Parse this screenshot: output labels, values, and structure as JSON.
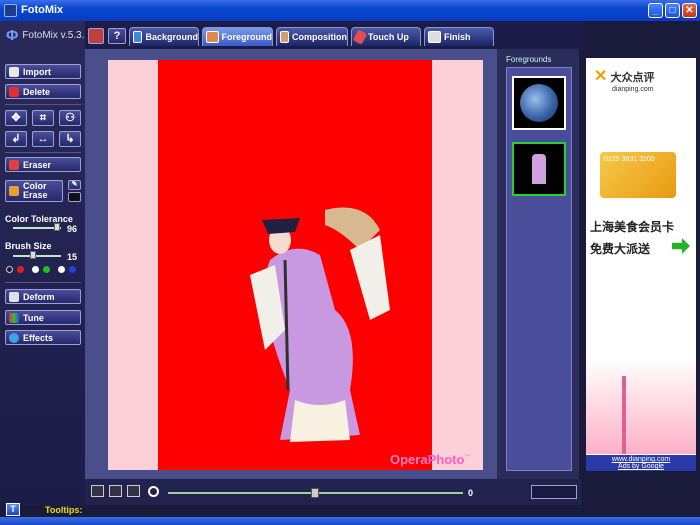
{
  "window": {
    "title": "FotoMix",
    "min": "_",
    "max": "□",
    "close": "✕"
  },
  "app": {
    "name": "FotoMix v.5.3."
  },
  "tabs": [
    {
      "label": "Background"
    },
    {
      "label": "Foreground"
    },
    {
      "label": "Composition"
    },
    {
      "label": "Touch Up"
    },
    {
      "label": "Finish"
    }
  ],
  "tools": {
    "import": "Import",
    "delete": "Delete",
    "eraser": "Eraser",
    "color_erase_1": "Color",
    "color_erase_2": "Erase",
    "color_tolerance_label": "Color Tolerance",
    "color_tolerance_value": "96",
    "brush_size_label": "Brush Size",
    "brush_size_value": "15",
    "deform": "Deform",
    "tune": "Tune",
    "effects": "Effects"
  },
  "canvas": {
    "watermark_a": "Opera",
    "watermark_b": "Photo",
    "watermark_tm": "™"
  },
  "foregrounds": {
    "label": "Foregrounds"
  },
  "zoom": {
    "value": "0"
  },
  "ad": {
    "brand_cn": "大众点评",
    "brand_en": "dianping.com",
    "card_text": "0125 3631 3200",
    "line1": "上海美食会员卡",
    "line2": "免费大派送",
    "link1": "www.dianping.com",
    "link2": "Ads by Google"
  },
  "tooltips": {
    "label": "Tooltips:",
    "icon": "T"
  },
  "help": "?"
}
